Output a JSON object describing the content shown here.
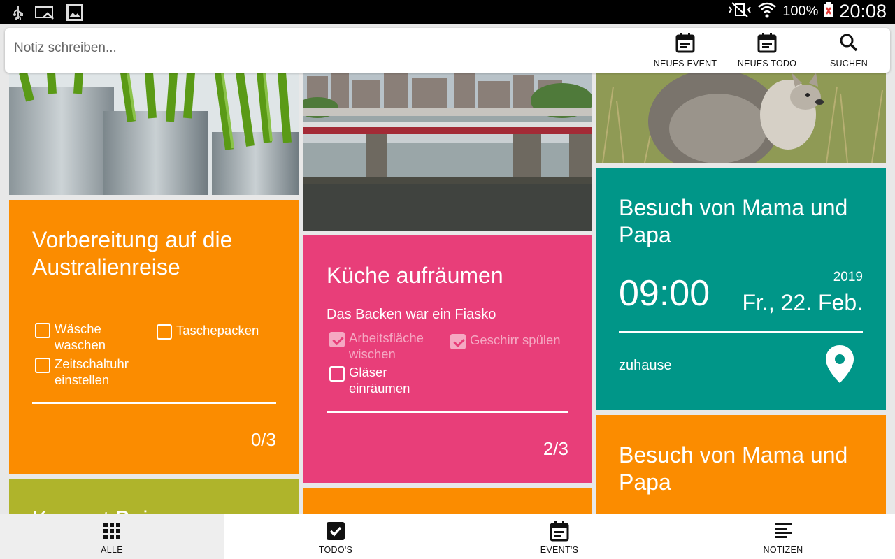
{
  "status_bar": {
    "battery": "100%",
    "time": "20:08"
  },
  "toolbar": {
    "note_placeholder": "Notiz schreiben...",
    "new_event": "NEUES EVENT",
    "new_todo": "NEUES TODO",
    "search": "SUCHEN"
  },
  "cards": {
    "australia": {
      "title_line1": "Vorbereitung auf die",
      "title_line2": "Australienreise",
      "items": [
        {
          "line1": "Wäsche",
          "line2": "waschen",
          "checked": false
        },
        {
          "line1": "Taschepacken",
          "line2": "",
          "checked": false
        },
        {
          "line1": "Zeitschaltuhr",
          "line2": "einstellen",
          "checked": false
        }
      ],
      "progress": "0/3",
      "color": "#fb8c00"
    },
    "kitchen": {
      "title": "Küche aufräumen",
      "subtitle": "Das Backen war ein Fiasko",
      "items": [
        {
          "line1": "Arbeitsfläche",
          "line2": "wischen",
          "checked": true
        },
        {
          "line1": "Geschirr spülen",
          "line2": "",
          "checked": true
        },
        {
          "line1": "Gläser",
          "line2": "einräumen",
          "checked": false
        }
      ],
      "progress": "2/3",
      "color": "#e83e79"
    },
    "visit_event": {
      "title_line1": "Besuch von Mama und",
      "title_line2": "Papa",
      "time": "09:00",
      "year": "2019",
      "date": "Fr., 22. Feb.",
      "location": "zuhause",
      "color": "#009688"
    },
    "visit_todo": {
      "title_line1": "Besuch von Mama und",
      "title_line2": "Papa",
      "color": "#fb8c00"
    },
    "partial": {
      "title": "Konzert Bei",
      "color": "#afb42b"
    }
  },
  "bottom_nav": {
    "all": "ALLE",
    "todos": "TODO'S",
    "events": "EVENT'S",
    "notes": "NOTIZEN"
  }
}
